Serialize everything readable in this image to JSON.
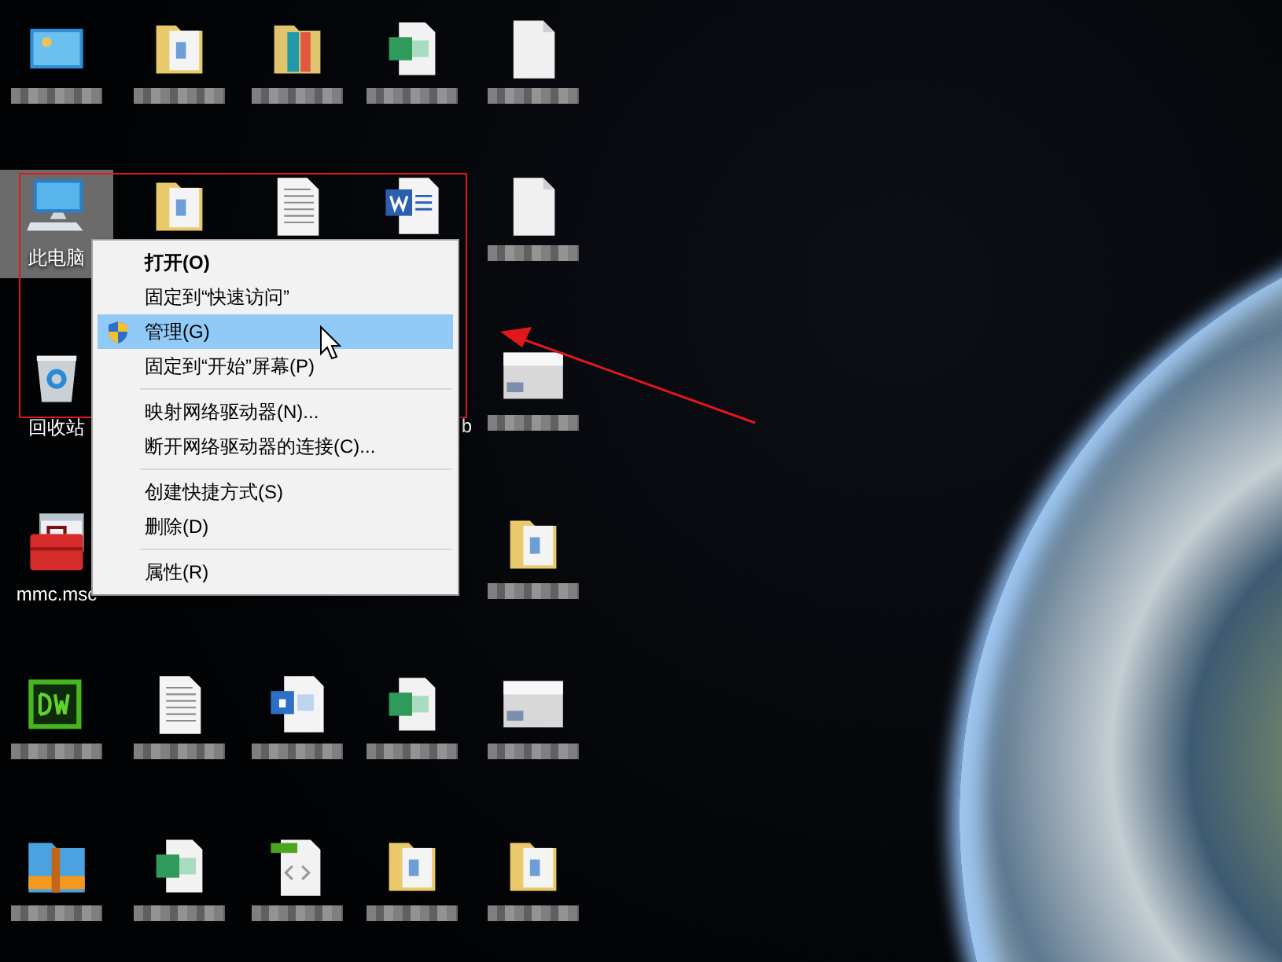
{
  "desktop_icons": [
    {
      "kind": "picture-screen"
    },
    {
      "kind": "folder-doc"
    },
    {
      "kind": "folder-color"
    },
    {
      "kind": "spreadsheet"
    },
    {
      "kind": "blank-file"
    },
    {
      "kind": "computer",
      "label": "此电脑",
      "selected": true
    },
    {
      "kind": "folder-doc"
    },
    {
      "kind": "text-file"
    },
    {
      "kind": "word-file"
    },
    {
      "kind": "blank-file"
    },
    {
      "kind": "recycle-bin",
      "label": "回收站",
      "selected": false
    },
    {
      "kind": "covered",
      "label": "b"
    },
    {
      "kind": "banner-image"
    },
    {
      "kind": "toolbox",
      "label": "mmc.msc",
      "selected": false
    },
    {
      "kind": "folder-doc"
    },
    {
      "kind": "web-editor"
    },
    {
      "kind": "text-file"
    },
    {
      "kind": "database-file"
    },
    {
      "kind": "spreadsheet"
    },
    {
      "kind": "banner-image"
    },
    {
      "kind": "archive"
    },
    {
      "kind": "spreadsheet"
    },
    {
      "kind": "code-file"
    },
    {
      "kind": "folder-doc"
    },
    {
      "kind": "folder-doc"
    }
  ],
  "context_menu": [
    {
      "kind": "item",
      "label": "打开(O)",
      "default": true,
      "selected": false
    },
    {
      "kind": "item",
      "label": "固定到“快速访问”",
      "default": false,
      "selected": false
    },
    {
      "kind": "shield-item",
      "label": "管理(G)",
      "default": false,
      "selected": true
    },
    {
      "kind": "item",
      "label": "固定到“开始”屏幕(P)",
      "default": false,
      "selected": false
    },
    {
      "kind": "separator"
    },
    {
      "kind": "item",
      "label": "映射网络驱动器(N)...",
      "default": false,
      "selected": false
    },
    {
      "kind": "item",
      "label": "断开网络驱动器的连接(C)...",
      "default": false,
      "selected": false
    },
    {
      "kind": "separator"
    },
    {
      "kind": "item",
      "label": "创建快捷方式(S)",
      "default": false,
      "selected": false
    },
    {
      "kind": "item",
      "label": "删除(D)",
      "default": false,
      "selected": false
    },
    {
      "kind": "separator"
    },
    {
      "kind": "item",
      "label": "属性(R)",
      "default": false,
      "selected": false
    }
  ]
}
